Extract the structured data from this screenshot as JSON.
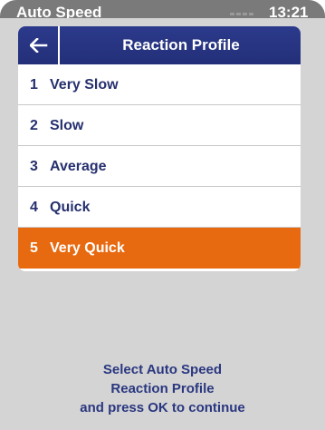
{
  "status_bar": {
    "title": "Auto Speed",
    "time": "13:21"
  },
  "header": {
    "back_icon": "arrow-left-icon",
    "title": "Reaction Profile"
  },
  "menu": {
    "items": [
      {
        "number": "1",
        "label": "Very Slow",
        "selected": false
      },
      {
        "number": "2",
        "label": "Slow",
        "selected": false
      },
      {
        "number": "3",
        "label": "Average",
        "selected": false
      },
      {
        "number": "4",
        "label": "Quick",
        "selected": false
      },
      {
        "number": "5",
        "label": "Very Quick",
        "selected": true
      }
    ]
  },
  "instruction": {
    "line1": "Select Auto Speed",
    "line2": "Reaction Profile",
    "line3": "and press OK to continue"
  },
  "colors": {
    "header_blue": "#2c3a8c",
    "selected_orange": "#e86a10",
    "text_blue": "#26306e",
    "background_gray": "#d4d4d4"
  }
}
